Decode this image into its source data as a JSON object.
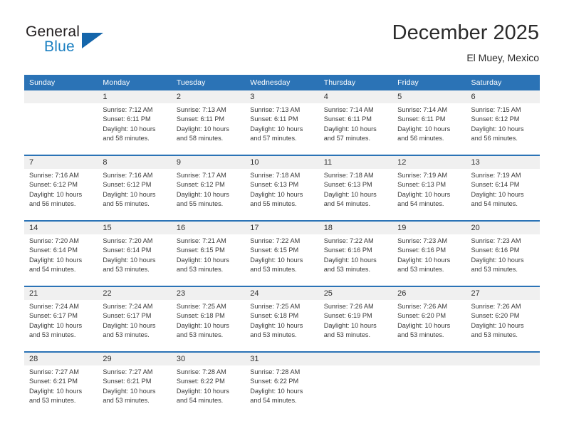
{
  "brand": {
    "word_general": "General",
    "word_blue": "Blue",
    "triangle_color": "#1566ab",
    "blue_color": "#1a7fc1"
  },
  "header": {
    "title": "December 2025",
    "location": "El Muey, Mexico"
  },
  "theme": {
    "header_bg": "#2b73b6",
    "daynum_band_bg": "#f0f0f0",
    "separator": "#2b73b6",
    "text": "#3a3a3a"
  },
  "weekdays": [
    "Sunday",
    "Monday",
    "Tuesday",
    "Wednesday",
    "Thursday",
    "Friday",
    "Saturday"
  ],
  "weeks": [
    [
      {
        "day": "",
        "sunrise": "",
        "sunset": "",
        "daylight1": "",
        "daylight2": ""
      },
      {
        "day": "1",
        "sunrise": "Sunrise: 7:12 AM",
        "sunset": "Sunset: 6:11 PM",
        "daylight1": "Daylight: 10 hours",
        "daylight2": "and 58 minutes."
      },
      {
        "day": "2",
        "sunrise": "Sunrise: 7:13 AM",
        "sunset": "Sunset: 6:11 PM",
        "daylight1": "Daylight: 10 hours",
        "daylight2": "and 58 minutes."
      },
      {
        "day": "3",
        "sunrise": "Sunrise: 7:13 AM",
        "sunset": "Sunset: 6:11 PM",
        "daylight1": "Daylight: 10 hours",
        "daylight2": "and 57 minutes."
      },
      {
        "day": "4",
        "sunrise": "Sunrise: 7:14 AM",
        "sunset": "Sunset: 6:11 PM",
        "daylight1": "Daylight: 10 hours",
        "daylight2": "and 57 minutes."
      },
      {
        "day": "5",
        "sunrise": "Sunrise: 7:14 AM",
        "sunset": "Sunset: 6:11 PM",
        "daylight1": "Daylight: 10 hours",
        "daylight2": "and 56 minutes."
      },
      {
        "day": "6",
        "sunrise": "Sunrise: 7:15 AM",
        "sunset": "Sunset: 6:12 PM",
        "daylight1": "Daylight: 10 hours",
        "daylight2": "and 56 minutes."
      }
    ],
    [
      {
        "day": "7",
        "sunrise": "Sunrise: 7:16 AM",
        "sunset": "Sunset: 6:12 PM",
        "daylight1": "Daylight: 10 hours",
        "daylight2": "and 56 minutes."
      },
      {
        "day": "8",
        "sunrise": "Sunrise: 7:16 AM",
        "sunset": "Sunset: 6:12 PM",
        "daylight1": "Daylight: 10 hours",
        "daylight2": "and 55 minutes."
      },
      {
        "day": "9",
        "sunrise": "Sunrise: 7:17 AM",
        "sunset": "Sunset: 6:12 PM",
        "daylight1": "Daylight: 10 hours",
        "daylight2": "and 55 minutes."
      },
      {
        "day": "10",
        "sunrise": "Sunrise: 7:18 AM",
        "sunset": "Sunset: 6:13 PM",
        "daylight1": "Daylight: 10 hours",
        "daylight2": "and 55 minutes."
      },
      {
        "day": "11",
        "sunrise": "Sunrise: 7:18 AM",
        "sunset": "Sunset: 6:13 PM",
        "daylight1": "Daylight: 10 hours",
        "daylight2": "and 54 minutes."
      },
      {
        "day": "12",
        "sunrise": "Sunrise: 7:19 AM",
        "sunset": "Sunset: 6:13 PM",
        "daylight1": "Daylight: 10 hours",
        "daylight2": "and 54 minutes."
      },
      {
        "day": "13",
        "sunrise": "Sunrise: 7:19 AM",
        "sunset": "Sunset: 6:14 PM",
        "daylight1": "Daylight: 10 hours",
        "daylight2": "and 54 minutes."
      }
    ],
    [
      {
        "day": "14",
        "sunrise": "Sunrise: 7:20 AM",
        "sunset": "Sunset: 6:14 PM",
        "daylight1": "Daylight: 10 hours",
        "daylight2": "and 54 minutes."
      },
      {
        "day": "15",
        "sunrise": "Sunrise: 7:20 AM",
        "sunset": "Sunset: 6:14 PM",
        "daylight1": "Daylight: 10 hours",
        "daylight2": "and 53 minutes."
      },
      {
        "day": "16",
        "sunrise": "Sunrise: 7:21 AM",
        "sunset": "Sunset: 6:15 PM",
        "daylight1": "Daylight: 10 hours",
        "daylight2": "and 53 minutes."
      },
      {
        "day": "17",
        "sunrise": "Sunrise: 7:22 AM",
        "sunset": "Sunset: 6:15 PM",
        "daylight1": "Daylight: 10 hours",
        "daylight2": "and 53 minutes."
      },
      {
        "day": "18",
        "sunrise": "Sunrise: 7:22 AM",
        "sunset": "Sunset: 6:16 PM",
        "daylight1": "Daylight: 10 hours",
        "daylight2": "and 53 minutes."
      },
      {
        "day": "19",
        "sunrise": "Sunrise: 7:23 AM",
        "sunset": "Sunset: 6:16 PM",
        "daylight1": "Daylight: 10 hours",
        "daylight2": "and 53 minutes."
      },
      {
        "day": "20",
        "sunrise": "Sunrise: 7:23 AM",
        "sunset": "Sunset: 6:16 PM",
        "daylight1": "Daylight: 10 hours",
        "daylight2": "and 53 minutes."
      }
    ],
    [
      {
        "day": "21",
        "sunrise": "Sunrise: 7:24 AM",
        "sunset": "Sunset: 6:17 PM",
        "daylight1": "Daylight: 10 hours",
        "daylight2": "and 53 minutes."
      },
      {
        "day": "22",
        "sunrise": "Sunrise: 7:24 AM",
        "sunset": "Sunset: 6:17 PM",
        "daylight1": "Daylight: 10 hours",
        "daylight2": "and 53 minutes."
      },
      {
        "day": "23",
        "sunrise": "Sunrise: 7:25 AM",
        "sunset": "Sunset: 6:18 PM",
        "daylight1": "Daylight: 10 hours",
        "daylight2": "and 53 minutes."
      },
      {
        "day": "24",
        "sunrise": "Sunrise: 7:25 AM",
        "sunset": "Sunset: 6:18 PM",
        "daylight1": "Daylight: 10 hours",
        "daylight2": "and 53 minutes."
      },
      {
        "day": "25",
        "sunrise": "Sunrise: 7:26 AM",
        "sunset": "Sunset: 6:19 PM",
        "daylight1": "Daylight: 10 hours",
        "daylight2": "and 53 minutes."
      },
      {
        "day": "26",
        "sunrise": "Sunrise: 7:26 AM",
        "sunset": "Sunset: 6:20 PM",
        "daylight1": "Daylight: 10 hours",
        "daylight2": "and 53 minutes."
      },
      {
        "day": "27",
        "sunrise": "Sunrise: 7:26 AM",
        "sunset": "Sunset: 6:20 PM",
        "daylight1": "Daylight: 10 hours",
        "daylight2": "and 53 minutes."
      }
    ],
    [
      {
        "day": "28",
        "sunrise": "Sunrise: 7:27 AM",
        "sunset": "Sunset: 6:21 PM",
        "daylight1": "Daylight: 10 hours",
        "daylight2": "and 53 minutes."
      },
      {
        "day": "29",
        "sunrise": "Sunrise: 7:27 AM",
        "sunset": "Sunset: 6:21 PM",
        "daylight1": "Daylight: 10 hours",
        "daylight2": "and 53 minutes."
      },
      {
        "day": "30",
        "sunrise": "Sunrise: 7:28 AM",
        "sunset": "Sunset: 6:22 PM",
        "daylight1": "Daylight: 10 hours",
        "daylight2": "and 54 minutes."
      },
      {
        "day": "31",
        "sunrise": "Sunrise: 7:28 AM",
        "sunset": "Sunset: 6:22 PM",
        "daylight1": "Daylight: 10 hours",
        "daylight2": "and 54 minutes."
      },
      {
        "day": "",
        "sunrise": "",
        "sunset": "",
        "daylight1": "",
        "daylight2": ""
      },
      {
        "day": "",
        "sunrise": "",
        "sunset": "",
        "daylight1": "",
        "daylight2": ""
      },
      {
        "day": "",
        "sunrise": "",
        "sunset": "",
        "daylight1": "",
        "daylight2": ""
      }
    ]
  ]
}
